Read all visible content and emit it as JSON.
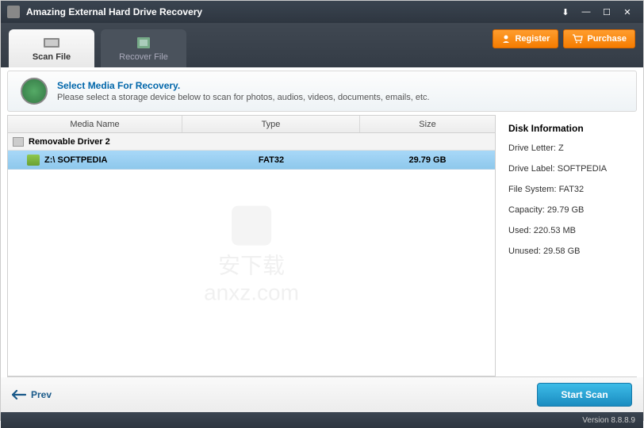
{
  "window": {
    "title": "Amazing External Hard Drive Recovery"
  },
  "tabs": {
    "scan": "Scan File",
    "recover": "Recover File"
  },
  "actions": {
    "register": "Register",
    "purchase": "Purchase"
  },
  "banner": {
    "title": "Select Media For Recovery.",
    "subtitle": "Please select a storage device below to scan for photos, audios, videos, documents, emails, etc."
  },
  "columns": {
    "name": "Media Name",
    "type": "Type",
    "size": "Size"
  },
  "group": {
    "label": "Removable Driver 2"
  },
  "row": {
    "name": "Z:\\ SOFTPEDIA",
    "type": "FAT32",
    "size": "29.79 GB"
  },
  "info": {
    "title": "Disk Information",
    "drive_letter": "Drive Letter: Z",
    "drive_label": "Drive Label: SOFTPEDIA",
    "file_system": "File System: FAT32",
    "capacity": "Capacity: 29.79 GB",
    "used": "Used: 220.53 MB",
    "unused": "Unused: 29.58 GB"
  },
  "footer": {
    "prev": "Prev",
    "scan": "Start Scan"
  },
  "status": {
    "version": "Version 8.8.8.9"
  },
  "watermark": {
    "line1": "安下载",
    "line2": "anxz.com"
  }
}
